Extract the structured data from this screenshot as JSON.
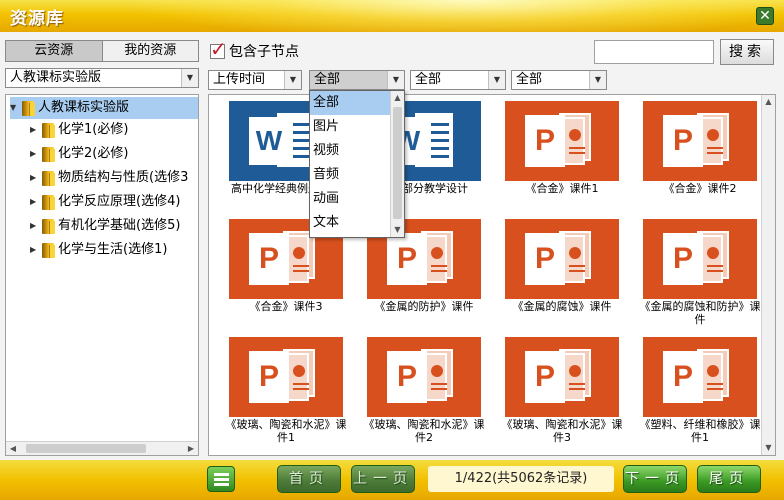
{
  "window": {
    "title": "资源库",
    "close_icon": "close-icon"
  },
  "left": {
    "tabs": [
      {
        "label": "云资源"
      },
      {
        "label": "我的资源"
      }
    ],
    "version_select": "人教课标实验版",
    "tree": {
      "root": "人教课标实验版",
      "items": [
        {
          "label": "化学1(必修)"
        },
        {
          "label": "化学2(必修)"
        },
        {
          "label": "物质结构与性质(选修3"
        },
        {
          "label": "化学反应原理(选修4)"
        },
        {
          "label": "有机化学基础(选修5)"
        },
        {
          "label": "化学与生活(选修1)"
        }
      ]
    }
  },
  "toolbar": {
    "include_sub_label": "包含子节点",
    "include_sub_checked": true,
    "search_placeholder": "",
    "search_button": "搜索",
    "filters": {
      "sort": "上传时间",
      "type": "全部",
      "f3": "全部",
      "f4": "全部"
    }
  },
  "type_dropdown": {
    "options": [
      "全部",
      "图片",
      "视频",
      "音频",
      "动画",
      "文本"
    ],
    "selected": "全部"
  },
  "resources": [
    {
      "type": "word",
      "caption": "高中化学经典例题解析"
    },
    {
      "type": "word",
      "caption": "化学部分教学设计"
    },
    {
      "type": "ppt",
      "caption": "《合金》课件1"
    },
    {
      "type": "ppt",
      "caption": "《合金》课件2"
    },
    {
      "type": "ppt",
      "caption": "《合金》课件3"
    },
    {
      "type": "ppt",
      "caption": "《金属的防护》课件"
    },
    {
      "type": "ppt",
      "caption": "《金属的腐蚀》课件"
    },
    {
      "type": "ppt",
      "caption": "《金属的腐蚀和防护》课件"
    },
    {
      "type": "ppt",
      "caption": "《玻璃、陶瓷和水泥》课件1"
    },
    {
      "type": "ppt",
      "caption": "《玻璃、陶瓷和水泥》课件2"
    },
    {
      "type": "ppt",
      "caption": "《玻璃、陶瓷和水泥》课件3"
    },
    {
      "type": "ppt",
      "caption": "《塑料、纤维和橡胶》课件1"
    }
  ],
  "footer": {
    "first_page": "首页",
    "prev_page": "上一页",
    "page_info": "1/422(共5062条记录)",
    "next_page": "下一页",
    "last_page": "尾页"
  },
  "colors": {
    "title_gold": "#f2c200",
    "word_blue": "#1f5b96",
    "ppt_orange": "#d8501e",
    "button_green": "#3a9a24",
    "selection_blue": "#a8cdf0"
  }
}
